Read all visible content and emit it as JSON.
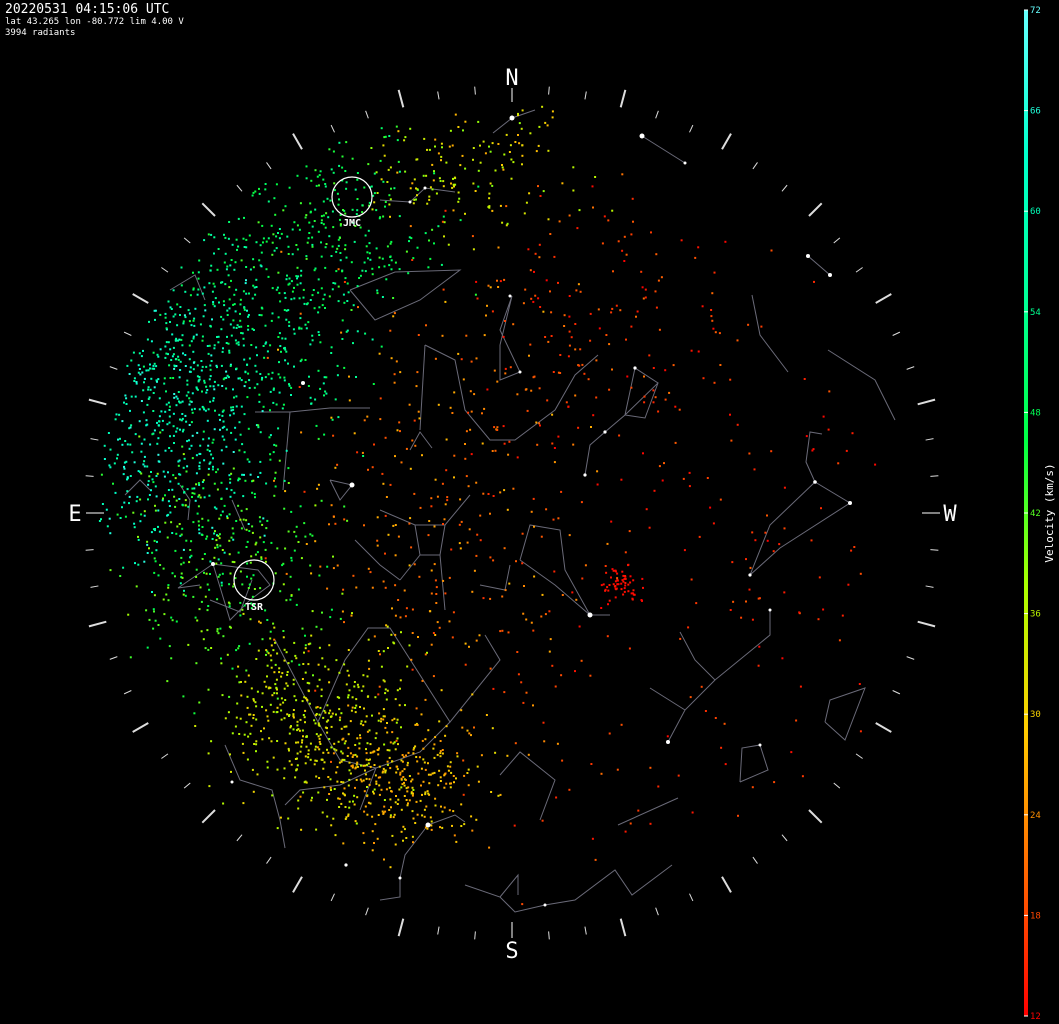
{
  "header": {
    "timestamp": "20220531 04:15:06 UTC",
    "location": "lat 43.265 lon -80.772 lim 4.00 V",
    "radiant_count": "3994 radiants"
  },
  "cardinals": {
    "north": "N",
    "south": "S",
    "east": "E",
    "west": "W"
  },
  "showers": [
    {
      "code": "JMC"
    },
    {
      "code": "TSR"
    }
  ],
  "colorbar": {
    "label": "Velocity (km/s)",
    "ticks": [
      "72",
      "66",
      "60",
      "54",
      "48",
      "42",
      "36",
      "30",
      "24",
      "18",
      "12"
    ],
    "min": 12,
    "max": 72,
    "colors": [
      "#ff0000",
      "#ff6600",
      "#ffcc00",
      "#aaff00",
      "#00ff44",
      "#00ff99",
      "#00ffcc",
      "#66ffff"
    ]
  },
  "chart_data": {
    "type": "scatter",
    "projection": "all-sky (alt/az, zenith at center)",
    "value_dimension": "velocity_km_s",
    "velocity_range": [
      12,
      72
    ],
    "total_radiants": 3994,
    "radiant_clusters": [
      {
        "region": "east-northeast sky",
        "velocity_km_s": [
          54,
          66
        ],
        "density": "high"
      },
      {
        "region": "east sky near JMC",
        "velocity_km_s": [
          44,
          54
        ],
        "density": "medium"
      },
      {
        "region": "southeast sky",
        "velocity_km_s": [
          28,
          36
        ],
        "density": "high"
      },
      {
        "region": "south-southeast sky",
        "velocity_km_s": [
          22,
          30
        ],
        "density": "medium"
      },
      {
        "region": "western sky near TSR antipode",
        "velocity_km_s": [
          12,
          18
        ],
        "density": "low"
      }
    ],
    "labeled_showers": [
      "JMC",
      "TSR"
    ]
  }
}
